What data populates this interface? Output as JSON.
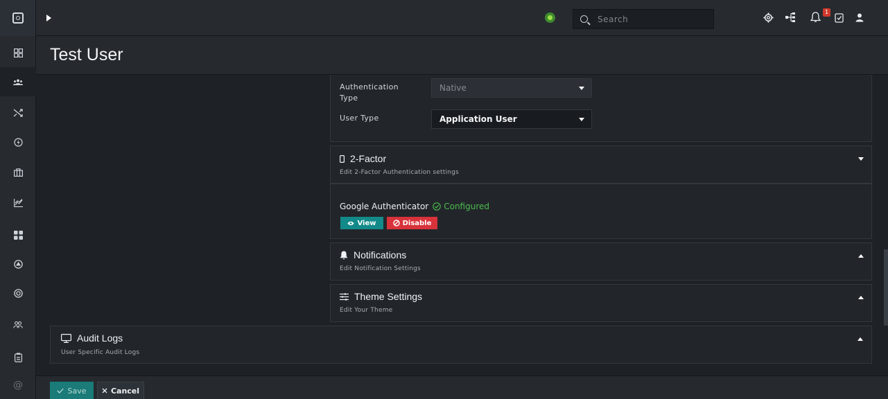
{
  "app": {
    "logo_icon": "shield-logo-icon",
    "search": {
      "placeholder": "Search"
    },
    "notifications_count": "1",
    "colors": {
      "accent": "#138a8a",
      "danger": "#d8323b",
      "success": "#4cbc4c",
      "badge": "#d0392b"
    }
  },
  "page": {
    "title": "Test User"
  },
  "account": {
    "auth_type_label": "Authentication Type",
    "auth_type_value": "Native",
    "user_type_label": "User Type",
    "user_type_value": "Application User"
  },
  "two_factor": {
    "title": "2-Factor",
    "subtitle": "Edit 2-Factor Authentication settings",
    "app_name": "Google Authenticator",
    "status": "Configured",
    "view_label": "View",
    "disable_label": "Disable"
  },
  "notifications": {
    "title": "Notifications",
    "subtitle": "Edit Notification Settings"
  },
  "theme": {
    "title": "Theme Settings",
    "subtitle": "Edit Your Theme"
  },
  "audit": {
    "title": "Audit Logs",
    "subtitle": "User Specific Audit Logs"
  },
  "footer": {
    "save_label": "Save",
    "cancel_label": "Cancel"
  }
}
